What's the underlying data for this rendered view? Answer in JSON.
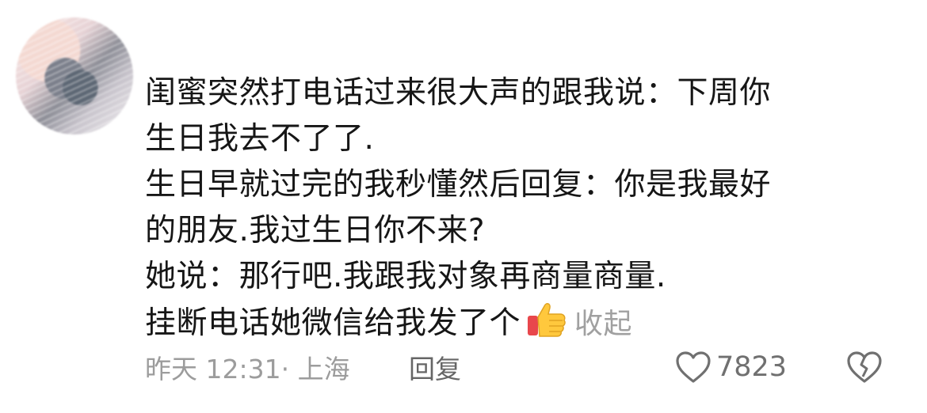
{
  "comment": {
    "lines": [
      "闺蜜突然打电话过来很大声的跟我说：下周你",
      "生日我去不了了.",
      "生日早就过完的我秒懂然后回复：你是我最好",
      "的朋友.我过生日你不来?",
      "她说：那行吧.我跟我对象再商量商量.",
      "挂断电话她微信给我发了个"
    ],
    "collapse_label": "收起",
    "emoji_icon": "thumbs-up-icon"
  },
  "meta": {
    "time_location": "昨天 12:31· 上海",
    "reply_label": "回复",
    "like_count": "7823",
    "like_icon": "heart-outline-icon",
    "dislike_icon": "broken-heart-outline-icon"
  }
}
